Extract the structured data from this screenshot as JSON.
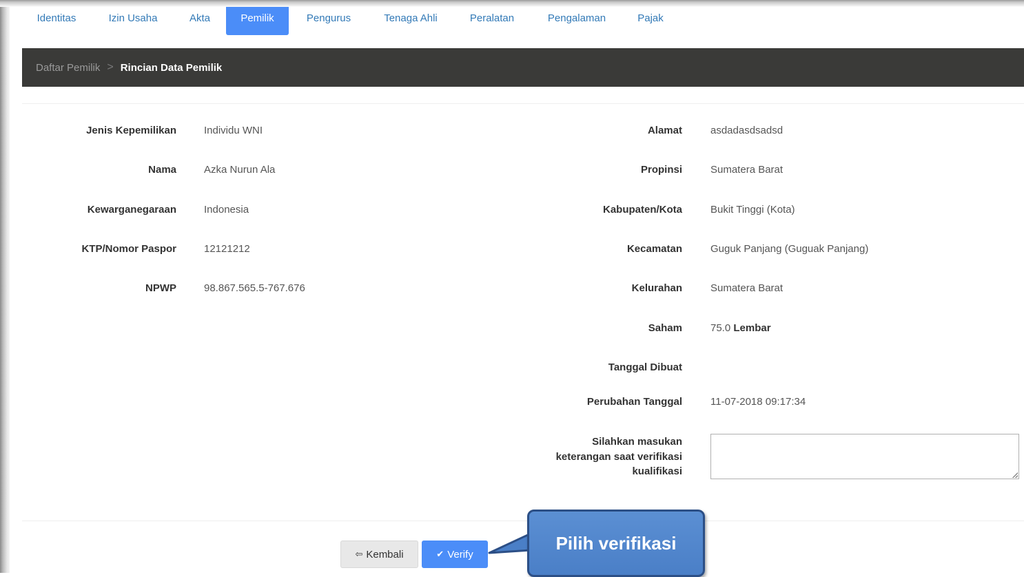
{
  "tabs": [
    {
      "label": "Identitas"
    },
    {
      "label": "Izin Usaha"
    },
    {
      "label": "Akta"
    },
    {
      "label": "Pemilik"
    },
    {
      "label": "Pengurus"
    },
    {
      "label": "Tenaga Ahli"
    },
    {
      "label": "Peralatan"
    },
    {
      "label": "Pengalaman"
    },
    {
      "label": "Pajak"
    }
  ],
  "active_tab": "Pemilik",
  "breadcrumb": {
    "parent": "Daftar Pemilik",
    "separator": ">",
    "current": "Rincian Data Pemilik"
  },
  "left_fields": [
    {
      "label": "Jenis Kepemilikan",
      "value": "Individu WNI"
    },
    {
      "label": "Nama",
      "value": "Azka Nurun Ala"
    },
    {
      "label": "Kewarganegaraan",
      "value": "Indonesia"
    },
    {
      "label": "KTP/Nomor Paspor",
      "value": "12121212"
    },
    {
      "label": "NPWP",
      "value": "98.867.565.5-767.676"
    }
  ],
  "right_fields": [
    {
      "label": "Alamat",
      "value": "asdadasdsadsd"
    },
    {
      "label": "Propinsi",
      "value": "Sumatera Barat"
    },
    {
      "label": "Kabupaten/Kota",
      "value": "Bukit Tinggi (Kota)"
    },
    {
      "label": "Kecamatan",
      "value": "Guguk Panjang (Guguak Panjang)"
    },
    {
      "label": "Kelurahan",
      "value": "Sumatera Barat"
    }
  ],
  "saham": {
    "label": "Saham",
    "value": "75.0",
    "unit": "Lembar"
  },
  "tanggal_dibuat": {
    "label": "Tanggal Dibuat",
    "value": ""
  },
  "perubahan_tanggal": {
    "label": "Perubahan Tanggal",
    "value": "11-07-2018 09:17:34"
  },
  "keterangan": {
    "label_lines": [
      "Silahkan masukan",
      "keterangan saat verifikasi",
      "kualifikasi"
    ],
    "value": ""
  },
  "buttons": {
    "back_label": "Kembali",
    "verify_label": "Verify"
  },
  "callout": {
    "text": "Pilih verifikasi"
  },
  "colors": {
    "accent": "#4b8df8",
    "breadcrumb_bg": "#3a3a38",
    "link": "#337ab7",
    "callout": "#4a7fc7"
  }
}
